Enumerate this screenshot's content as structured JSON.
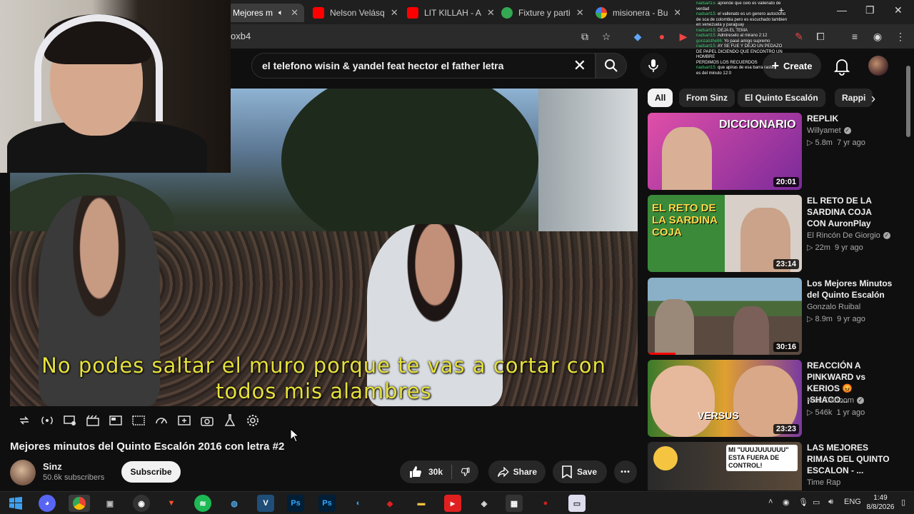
{
  "browser": {
    "tabs": [
      {
        "label": "Mejores m",
        "icon": "youtube-icon",
        "active": true,
        "audio": true
      },
      {
        "label": "Nelson Velásq",
        "icon": "youtube-icon"
      },
      {
        "label": "LIT KILLAH - A",
        "icon": "youtube-icon"
      },
      {
        "label": "Fixture y parti",
        "icon": "ball-icon"
      },
      {
        "label": "misionera - Bu",
        "icon": "google-icon"
      }
    ],
    "new_tab_symbol": "+",
    "url_fragment": "oxb4"
  },
  "youtube": {
    "search_query": "el telefono wisin & yandel feat hector el father letra",
    "create_label": "Create",
    "chips": [
      "All",
      "From Sinz",
      "El Quinto Escalón",
      "Rappi"
    ],
    "video": {
      "subtitle_line1": "No podes saltar el muro porque te vas a cortar con",
      "subtitle_line2": "todos mis alambres",
      "title": "Mejores minutos del Quinto Escalón 2016 con letra #2",
      "channel": "Sinz",
      "subscribers": "50.6k subscribers",
      "subscribe_label": "Subscribe",
      "likes": "30k",
      "share_label": "Share",
      "save_label": "Save",
      "more_label": "•••"
    },
    "recommendations": [
      {
        "title": "REPLIK",
        "channel": "Willyamet",
        "views": "5.8m",
        "age": "7 yr ago",
        "duration": "20:01",
        "thumb_text": "DICCIONARIO",
        "verified": true
      },
      {
        "title": "EL RETO DE LA SARDINA COJA CON AuronPlay",
        "channel": "El Rincón De Giorgio",
        "views": "22m",
        "age": "9 yr ago",
        "duration": "23:14",
        "thumb_text": "EL RETO DE LA SARDINA COJA",
        "verified": true
      },
      {
        "title": "Los Mejores Minutos del Quinto Escalón",
        "channel": "Gonzalo Ruibal",
        "views": "8.9m",
        "age": "9 yr ago",
        "duration": "30:16",
        "thumb_text": "",
        "verified": false
      },
      {
        "title": "REACCIÓN A PINKWARD vs KERIOS 😡 ¡SHACO...",
        "channel": "Nick Daboom",
        "views": "546k",
        "age": "1 yr ago",
        "duration": "23:23",
        "thumb_text": "VERSUS",
        "verified": true
      },
      {
        "title": "LAS MEJORES RIMAS DEL QUINTO ESCALON - ...",
        "channel": "Time Rap",
        "views": "",
        "age": "",
        "duration": "",
        "thumb_text": "MI \"UUUJUUUUUU\" ESTA FUERA DE CONTROL!",
        "verified": false
      }
    ]
  },
  "chat_overlay": {
    "lines": [
      {
        "user": "nadsart15:",
        "text": "aprende que celo es vallenato de verdad"
      },
      {
        "user": "nadsart15:",
        "text": "el vallenato es un genero autoctono de sca de colombia pero es escuchado tambien en venezuela y paraguay"
      },
      {
        "user": "nadsart15:",
        "text": "DEJA EL TEMA"
      },
      {
        "user": "nadsart15:",
        "text": "Admireselo al mirano 2:12"
      },
      {
        "user": "gonzalsthe86:",
        "text": "Yo pasé amigo supremo"
      },
      {
        "user": "nadsart15:",
        "text": "AY SE FUE Y DEJO UN PEDAZO DE PAPEL DICIENDO QUE ENCONTRO UN HOMBRE"
      },
      {
        "user": "",
        "text": "PERDIMOS LOS RECUERDOS"
      },
      {
        "user": "nadsart15:",
        "text": "que apiras de esa barra rasta"
      },
      {
        "user": "",
        "text": "es del minuto 12:0"
      }
    ]
  },
  "taskbar": {
    "lang": "ENG",
    "time": "1:49",
    "date": "8/8/2026"
  },
  "colors": {
    "subtitle": "#e6e13c",
    "youtube_red": "#ff0000",
    "accent_progress": "#ff0000"
  }
}
